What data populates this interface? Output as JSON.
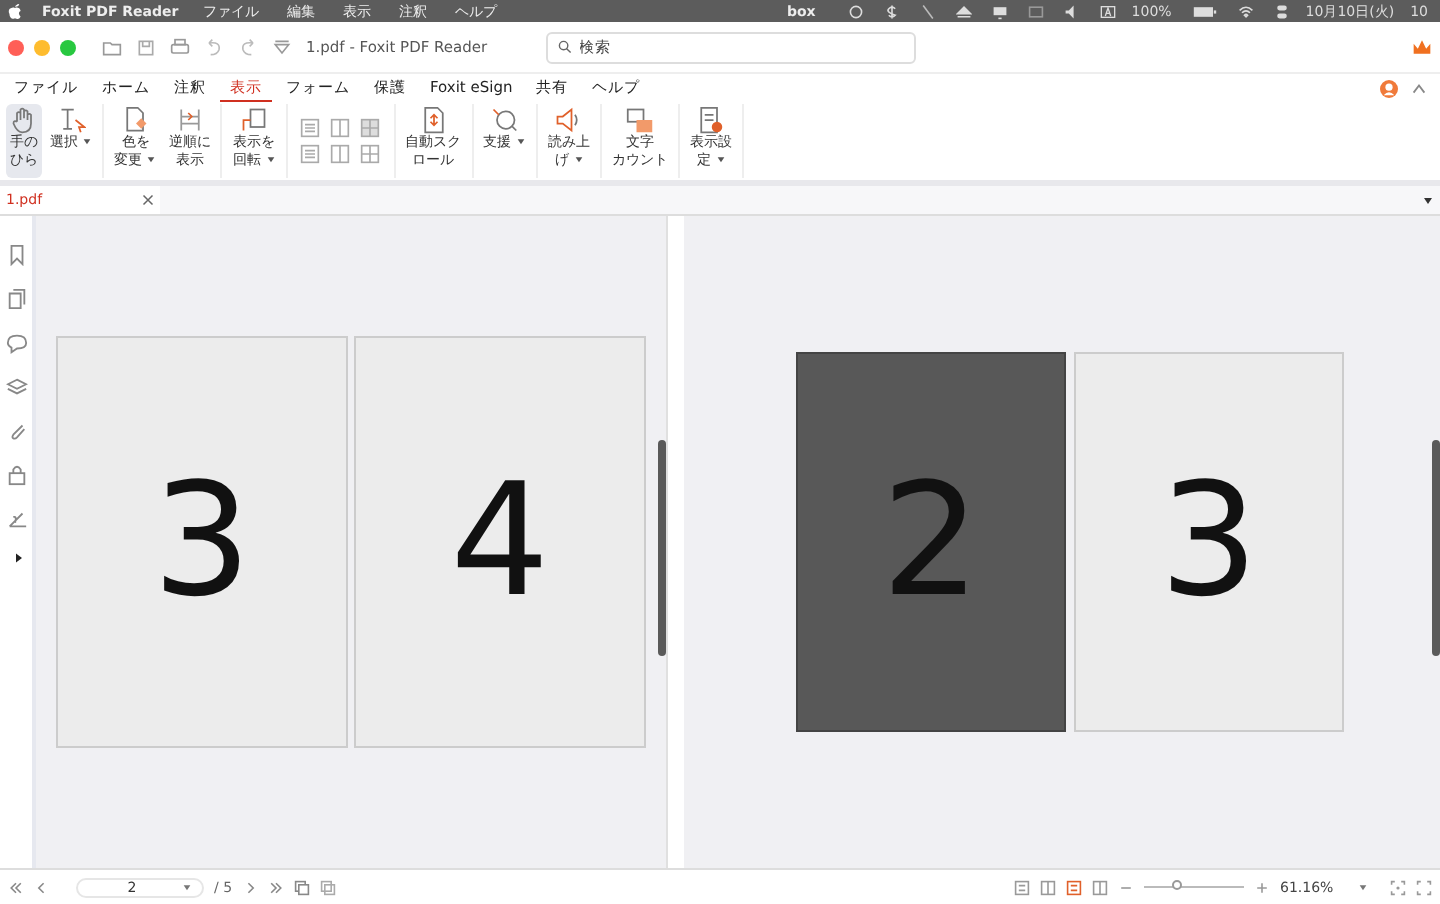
{
  "system_menubar": {
    "app_name": "Foxit PDF Reader",
    "items": [
      "ファイル",
      "編集",
      "表示",
      "注釈",
      "ヘルプ"
    ],
    "box_label": "box",
    "battery": "100%",
    "date": "10月10日(火)",
    "time_cut": "10"
  },
  "titlebar": {
    "title": "1.pdf - Foxit PDF Reader",
    "search": {
      "placeholder": "検索"
    }
  },
  "menu_tabs": [
    {
      "label": "ファイル",
      "selected": false
    },
    {
      "label": "ホーム",
      "selected": false
    },
    {
      "label": "注釈",
      "selected": false
    },
    {
      "label": "表示",
      "selected": true
    },
    {
      "label": "フォーム",
      "selected": false
    },
    {
      "label": "保護",
      "selected": false
    },
    {
      "label": "Foxit eSign",
      "selected": false
    },
    {
      "label": "共有",
      "selected": false
    },
    {
      "label": "ヘルプ",
      "selected": false
    }
  ],
  "ribbon": [
    [
      {
        "kind": "hand",
        "label": "手のひら",
        "selected": true,
        "menu": false
      },
      {
        "kind": "select",
        "label": "選択",
        "selected": false,
        "menu": true
      }
    ],
    [
      {
        "kind": "color",
        "label": "色を変更",
        "selected": false,
        "menu": true
      },
      {
        "kind": "reverse",
        "label": "逆順に表示",
        "selected": false,
        "menu": false
      }
    ],
    [
      {
        "kind": "rotate",
        "label": "表示を回転",
        "selected": false,
        "menu": true
      }
    ],
    [
      {
        "kind": "views"
      }
    ],
    [
      {
        "kind": "scroll",
        "label": "自動スクロール",
        "selected": false,
        "menu": false
      }
    ],
    [
      {
        "kind": "assist",
        "label": "支援",
        "selected": false,
        "menu": true
      }
    ],
    [
      {
        "kind": "speak",
        "label": "読み上げ",
        "selected": false,
        "menu": true
      }
    ],
    [
      {
        "kind": "count",
        "label": "文字カウント",
        "selected": false,
        "menu": false
      }
    ],
    [
      {
        "kind": "settings",
        "label": "表示設定",
        "selected": false,
        "menu": true
      }
    ]
  ],
  "doc_tabs": [
    {
      "label": "1.pdf",
      "selected": true
    }
  ],
  "panes": [
    {
      "pages": [
        {
          "number": "3",
          "dark": false
        },
        {
          "number": "4",
          "dark": false
        }
      ]
    },
    {
      "pages": [
        {
          "number": "2",
          "dark": true
        },
        {
          "number": "3",
          "dark": false
        }
      ]
    }
  ],
  "status_bar": {
    "page": "2",
    "total": "/ 5",
    "view_modes": [
      {
        "selected": false
      },
      {
        "selected": false
      },
      {
        "selected": true
      },
      {
        "selected": false
      }
    ],
    "zoom": {
      "level": 0.33,
      "value": "61.16%"
    }
  }
}
